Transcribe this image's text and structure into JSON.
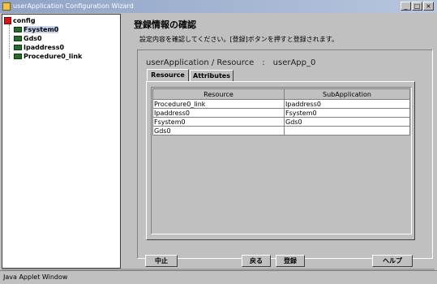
{
  "window": {
    "title": "userApplication Configuration Wizard",
    "minimize": "_",
    "maximize": "□",
    "close": "×"
  },
  "tree": {
    "root": "config",
    "items": [
      {
        "label": "Fsystem0",
        "selected": true
      },
      {
        "label": "Gds0",
        "selected": false
      },
      {
        "label": "Ipaddress0",
        "selected": false
      },
      {
        "label": "Procedure0_link",
        "selected": false
      }
    ]
  },
  "main": {
    "heading": "登録情報の確認",
    "description": "設定内容を確認してください。[登録]ボタンを押すと登録されます。",
    "resource_title": {
      "left": "userApplication / Resource",
      "separator": ":",
      "right": "userApp_0"
    },
    "tabs": [
      {
        "label": "Resource",
        "active": true
      },
      {
        "label": "Attributes",
        "active": false
      }
    ],
    "table": {
      "headers": [
        "Resource",
        "SubApplication"
      ],
      "rows": [
        [
          "Procedure0_link",
          "Ipaddress0"
        ],
        [
          "Ipaddress0",
          "Fsystem0"
        ],
        [
          "Fsystem0",
          "Gds0"
        ],
        [
          "Gds0",
          ""
        ]
      ]
    },
    "buttons": {
      "cancel": "中止",
      "back": "戻る",
      "register": "登録",
      "help": "ヘルプ"
    }
  },
  "statusbar": {
    "text": "Java Applet Window"
  }
}
